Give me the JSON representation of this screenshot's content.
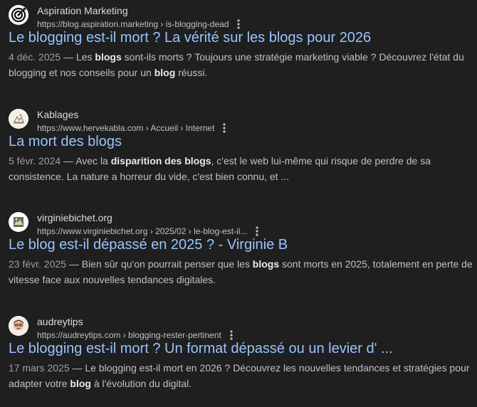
{
  "results": [
    {
      "site_name": "Aspiration Marketing",
      "cite": "https://blog.aspiration.marketing › is-blogging-dead",
      "title": "Le blogging est-il mort ? La vérité sur les blogs pour 2026",
      "date": "4 déc. 2025",
      "snippet": [
        {
          "t": "Les ",
          "b": false
        },
        {
          "t": "blogs",
          "b": true
        },
        {
          "t": " sont-ils morts ? Toujours une stratégie marketing viable ? Découvrez l'état du blogging et nos conseils pour un ",
          "b": false
        },
        {
          "t": "blog",
          "b": true
        },
        {
          "t": " réussi.",
          "b": false
        }
      ],
      "favicon": "target-logo-icon"
    },
    {
      "site_name": "Kablages",
      "cite": "https://www.hervekabla.com › Accueil › Internet",
      "title": "La mort des blogs",
      "date": "5 févr. 2024",
      "snippet": [
        {
          "t": "Avec la ",
          "b": false
        },
        {
          "t": "disparition des blogs",
          "b": true
        },
        {
          "t": ", c'est le web lui-même qui risque de perdre de sa consistence. La nature a horreur du vide, c'est bien connu, et ...",
          "b": false
        }
      ],
      "favicon": "sketch-logo-icon"
    },
    {
      "site_name": "virginiebichet.org",
      "cite": "https://www.virginiebichet.org › 2025/02 › le-blog-est-il...",
      "title": "Le blog est-il dépassé en 2025 ? - Virginie B",
      "date": "23 févr. 2025",
      "snippet": [
        {
          "t": "Bien sûr qu'on pourrait penser que les ",
          "b": false
        },
        {
          "t": "blogs",
          "b": true
        },
        {
          "t": " sont morts en 2025, totalement en perte de vitesse face aux nouvelles tendances digitales.",
          "b": false
        }
      ],
      "favicon": "photo-logo-icon"
    },
    {
      "site_name": "audreytips",
      "cite": "https://audreytips.com › blogging-rester-pertinent",
      "title": "Le blogging est-il mort ? Un format dépassé ou un levier d' ...",
      "date": "17 mars 2025",
      "snippet": [
        {
          "t": "Le blogging est-il mort en 2026 ? Découvrez les nouvelles tendances et stratégies pour adapter votre ",
          "b": false
        },
        {
          "t": "blog",
          "b": true
        },
        {
          "t": " à l'évolution du digital.",
          "b": false
        }
      ],
      "favicon": "avatar-logo-icon"
    }
  ],
  "date_separator": " — ",
  "colors": {
    "background": "#1f1f1f",
    "title_link": "#99c3ff",
    "text": "#bdc1c6",
    "bold_text": "#e8eaed"
  },
  "more_icon": "three-dots-vertical-icon"
}
